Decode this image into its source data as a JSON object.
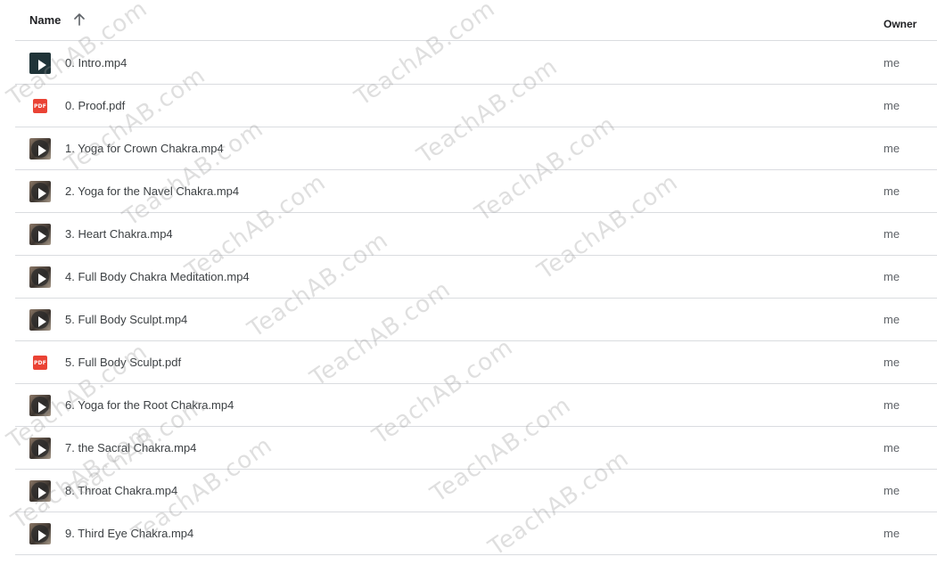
{
  "header": {
    "name_label": "Name",
    "owner_label": "Owner",
    "sort_icon": "arrow-up-icon"
  },
  "files": [
    {
      "name": "0. Intro.mp4",
      "owner": "me",
      "type": "video",
      "icon": "video-thumbnail-icon"
    },
    {
      "name": "0. Proof.pdf",
      "owner": "me",
      "type": "pdf",
      "icon": "pdf-icon"
    },
    {
      "name": "1. Yoga for Crown Chakra.mp4",
      "owner": "me",
      "type": "video",
      "icon": "video-thumbnail-icon"
    },
    {
      "name": "2. Yoga for the Navel Chakra.mp4",
      "owner": "me",
      "type": "video",
      "icon": "video-thumbnail-icon"
    },
    {
      "name": "3. Heart Chakra.mp4",
      "owner": "me",
      "type": "video",
      "icon": "video-thumbnail-icon"
    },
    {
      "name": "4. Full Body Chakra Meditation.mp4",
      "owner": "me",
      "type": "video",
      "icon": "video-thumbnail-icon"
    },
    {
      "name": "5. Full Body Sculpt.mp4",
      "owner": "me",
      "type": "video",
      "icon": "video-thumbnail-icon"
    },
    {
      "name": "5. Full Body Sculpt.pdf",
      "owner": "me",
      "type": "pdf",
      "icon": "pdf-icon"
    },
    {
      "name": "6. Yoga for the Root Chakra.mp4",
      "owner": "me",
      "type": "video",
      "icon": "video-thumbnail-icon"
    },
    {
      "name": "7. the Sacral Chakra.mp4",
      "owner": "me",
      "type": "video",
      "icon": "video-thumbnail-icon"
    },
    {
      "name": "8. Throat Chakra.mp4",
      "owner": "me",
      "type": "video",
      "icon": "video-thumbnail-icon"
    },
    {
      "name": "9. Third Eye Chakra.mp4",
      "owner": "me",
      "type": "video",
      "icon": "video-thumbnail-icon"
    }
  ],
  "pdf_icon_text": "PDF",
  "watermark_text": "TeachAB.com",
  "colors": {
    "pdf_red": "#ea4335",
    "divider": "#dadce0",
    "text": "#3c4043"
  }
}
